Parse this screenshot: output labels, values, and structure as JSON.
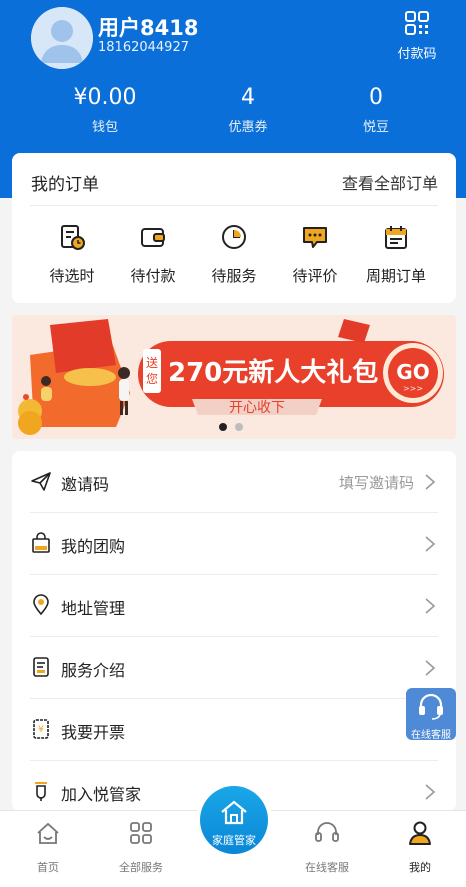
{
  "profile": {
    "name": "用户8418",
    "phone": "18162044927",
    "paycode_label": "付款码"
  },
  "stats": [
    {
      "value": "¥0.00",
      "label": "钱包"
    },
    {
      "value": "4",
      "label": "优惠券"
    },
    {
      "value": "0",
      "label": "悦豆"
    }
  ],
  "orders": {
    "title": "我的订单",
    "view_all": "查看全部订单",
    "items": [
      {
        "label": "待选时",
        "icon": "schedule-doc-icon"
      },
      {
        "label": "待付款",
        "icon": "wallet-icon"
      },
      {
        "label": "待服务",
        "icon": "clock-icon"
      },
      {
        "label": "待评价",
        "icon": "comment-icon"
      },
      {
        "label": "周期订单",
        "icon": "calendar-icon"
      }
    ]
  },
  "banner": {
    "tag": "送您",
    "headline": "270元新人大礼包",
    "go": "GO",
    "button": "开心收下",
    "active_slide": 1,
    "slide_count": 2
  },
  "menu": [
    {
      "label": "邀请码",
      "hint": "填写邀请码",
      "icon": "paper-plane-icon"
    },
    {
      "label": "我的团购",
      "hint": "",
      "icon": "shopping-bag-icon"
    },
    {
      "label": "地址管理",
      "hint": "",
      "icon": "location-pin-icon"
    },
    {
      "label": "服务介绍",
      "hint": "",
      "icon": "document-icon"
    },
    {
      "label": "我要开票",
      "hint": "",
      "icon": "invoice-icon"
    },
    {
      "label": "加入悦管家",
      "hint": "",
      "icon": "join-badge-icon"
    }
  ],
  "float_service": {
    "label": "在线客服"
  },
  "tabbar": {
    "items": [
      {
        "label": "首页"
      },
      {
        "label": "全部服务"
      },
      {
        "label": "家庭管家"
      },
      {
        "label": "在线客服"
      },
      {
        "label": "我的"
      }
    ],
    "active": "我的"
  },
  "colors": {
    "header_blue": "#0a6fd8",
    "accent_orange": "#f0a61e",
    "banner_red": "#e8402a",
    "float_blue": "#4f8ad6"
  }
}
